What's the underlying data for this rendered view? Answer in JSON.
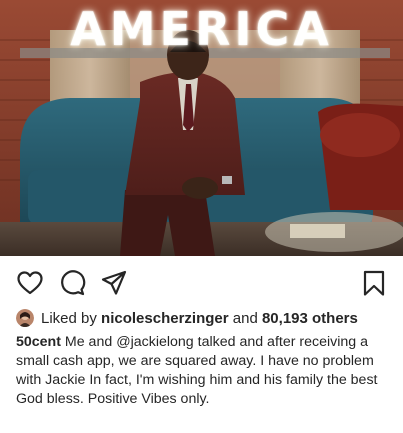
{
  "photo": {
    "sign_text": "AMERICA",
    "description_icon": "photo"
  },
  "actions": {
    "like_icon": "heart-icon",
    "comment_icon": "comment-icon",
    "share_icon": "paper-plane-icon",
    "save_icon": "bookmark-icon"
  },
  "likes": {
    "prefix": "Liked by",
    "user": "nicolescherzinger",
    "connector": "and",
    "count": "80,193 others"
  },
  "caption": {
    "username": "50cent",
    "part1": "Me and",
    "mention": "@jackielong",
    "part2": "talked and after receiving a small cash app, we are squared away. I have no problem with Jackie In fact, I'm wishing him and his family the best God bless. Positive Vibes only."
  },
  "colors": {
    "text": "#262626",
    "muted": "#8e8e8e"
  }
}
